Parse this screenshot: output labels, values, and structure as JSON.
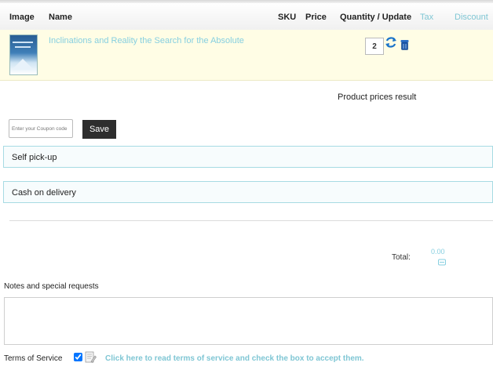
{
  "table": {
    "headers": {
      "image": "Image",
      "name": "Name",
      "sku": "SKU",
      "price": "Price",
      "quantity_update": "Quantity / Update",
      "tax": "Tax",
      "discount": "Discount"
    },
    "rows": [
      {
        "name": "Inclinations and Reality the Search for the Absolute",
        "quantity": "2"
      }
    ]
  },
  "summary": {
    "product_prices_result": "Product prices result"
  },
  "coupon": {
    "placeholder": "Enter your Coupon code",
    "save_label": "Save"
  },
  "shipment": {
    "option_label": "Self pick-up"
  },
  "payment": {
    "option_label": "Cash on delivery"
  },
  "totals": {
    "label": "Total:",
    "value": "0.00"
  },
  "notes": {
    "label": "Notes and special requests"
  },
  "tos": {
    "label": "Terms of Service",
    "checked": true,
    "link_text": "Click here to read terms of service and check the box to accept them."
  },
  "colors": {
    "link": "#86cfe0",
    "save_button_bg": "#2e2e2e",
    "product_row_bg": "#fffde5",
    "option_border": "#a7dbe3"
  },
  "icons": {
    "refresh": "refresh-icon",
    "delete": "trash-icon",
    "currency": "currency-icon",
    "terms_doc": "document-icon"
  }
}
